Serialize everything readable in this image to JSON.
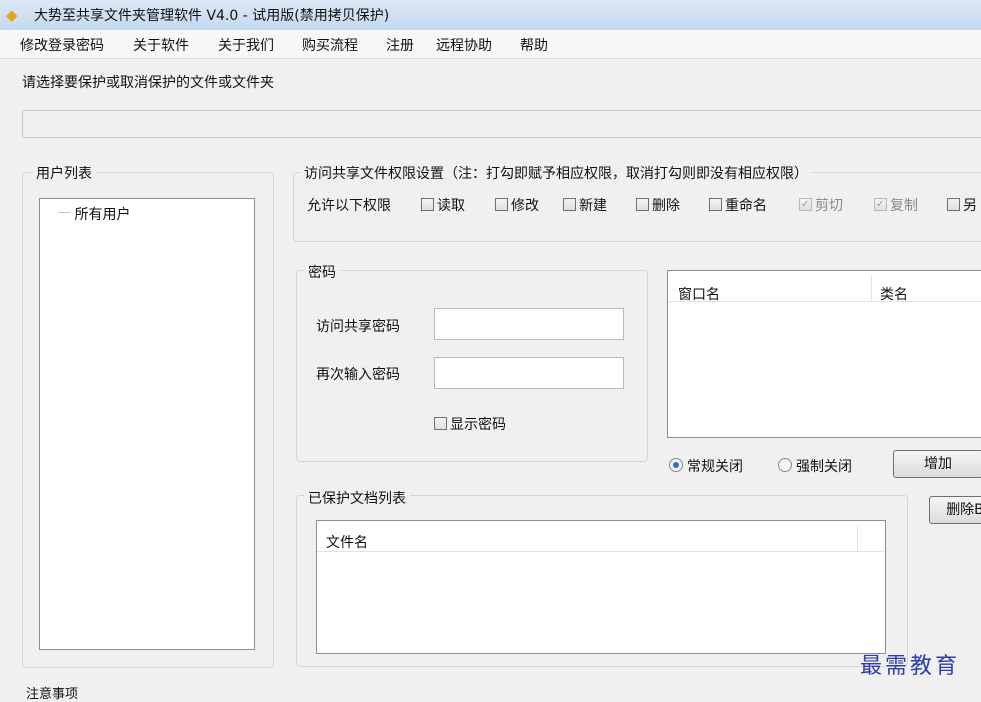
{
  "window": {
    "title": "大势至共享文件夹管理软件 V4.0 - 试用版(禁用拷贝保护)"
  },
  "menu": [
    "修改登录密码",
    "关于软件",
    "关于我们",
    "购买流程",
    "注册",
    "远程协助",
    "帮助"
  ],
  "instruction": "请选择要保护或取消保护的文件或文件夹",
  "path_value": "",
  "user_list": {
    "label": "用户列表",
    "items": [
      "所有用户"
    ]
  },
  "permissions": {
    "label": "访问共享文件权限设置（注：打勾即赋予相应权限，取消打勾则即没有相应权限）",
    "allow_label": "允许以下权限",
    "items": [
      {
        "label": "读取",
        "checked": false,
        "enabled": true
      },
      {
        "label": "修改",
        "checked": false,
        "enabled": true
      },
      {
        "label": "新建",
        "checked": false,
        "enabled": true
      },
      {
        "label": "删除",
        "checked": false,
        "enabled": true
      },
      {
        "label": "重命名",
        "checked": false,
        "enabled": true
      },
      {
        "label": "剪切",
        "checked": true,
        "enabled": false
      },
      {
        "label": "复制",
        "checked": true,
        "enabled": false
      },
      {
        "label": "另",
        "checked": false,
        "enabled": true
      }
    ]
  },
  "password": {
    "label": "密码",
    "access_label": "访问共享密码",
    "access_value": "",
    "confirm_label": "再次输入密码",
    "confirm_value": "",
    "show_label": "显示密码"
  },
  "window_list": {
    "columns": [
      "窗口名",
      "类名"
    ]
  },
  "close_mode": {
    "normal": "常规关闭",
    "force": "强制关闭",
    "selected": "normal"
  },
  "buttons": {
    "add": "增加",
    "delete": "删除B"
  },
  "protected_list": {
    "label": "已保护文档列表",
    "columns": [
      "文件名"
    ]
  },
  "notes_label": "注意事项",
  "watermark": "最需教育"
}
